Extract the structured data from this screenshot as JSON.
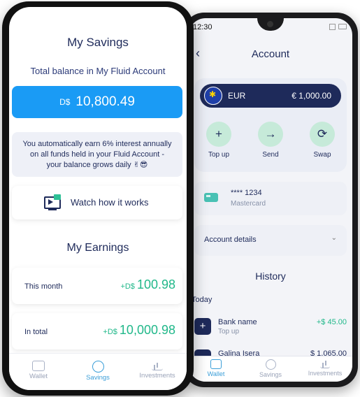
{
  "right_phone": {
    "status_time": "12:30",
    "title": "Account",
    "account": {
      "currency": "EUR",
      "amount": "€ 1,000.00"
    },
    "actions": [
      {
        "label": "Top up",
        "icon": "+"
      },
      {
        "label": "Send",
        "icon": "→"
      },
      {
        "label": "Swap",
        "icon": "⟳"
      }
    ],
    "card": {
      "number": "**** 1234",
      "type": "Mastercard"
    },
    "account_details_label": "Account details",
    "history_title": "History",
    "history_group": "Today",
    "history": [
      {
        "name": "Bank name",
        "sub": "Top up",
        "amount": "+$ 45.00",
        "icon": "+"
      },
      {
        "name": "Galina Isera",
        "sub": "",
        "amount": "$ 1,065.00",
        "icon": ""
      }
    ],
    "tabs": [
      "Wallet",
      "Savings",
      "Investments"
    ],
    "active_tab": "Wallet"
  },
  "left_phone": {
    "title": "My Savings",
    "total_label": "Total balance in My Fluid Account",
    "balance": {
      "currency": "D$",
      "amount": "10,800.49"
    },
    "info_text": "You automatically earn 6% interest annually on all funds held in your Fluid Account - your balance grows daily ✌😎",
    "watch_label": "Watch how it works",
    "earnings_title": "My Earnings",
    "earnings": [
      {
        "label": "This month",
        "currency": "+D$",
        "amount": "100.98"
      },
      {
        "label": "In total",
        "currency": "+D$",
        "amount": "10,000.98"
      }
    ],
    "tabs": [
      "Wallet",
      "Savings",
      "Investments"
    ],
    "active_tab": "Savings"
  },
  "colors": {
    "primary_navy": "#1e2a5a",
    "balance_blue": "#1a9bf5",
    "positive_green": "#21b88a",
    "action_mint": "#c6ead9",
    "active_tab_blue": "#3a9ed8"
  }
}
